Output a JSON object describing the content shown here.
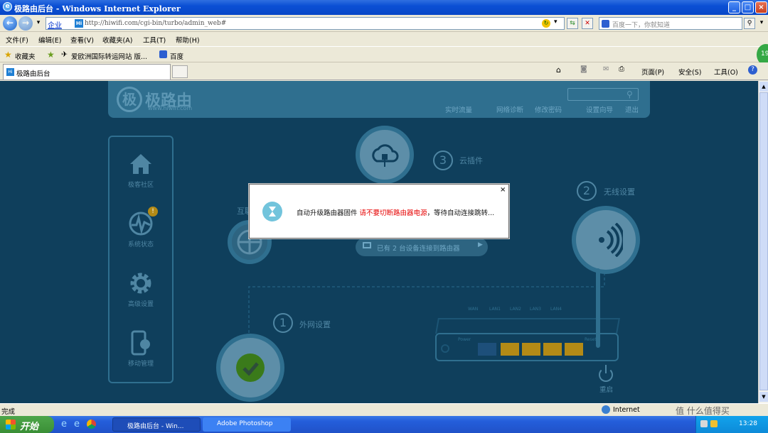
{
  "window": {
    "title": "极路由后台 - Windows Internet Explorer"
  },
  "address": {
    "zone": "企业",
    "url": "http://hiwifi.com/cgi-bin/turbo/admin_web#",
    "search_placeholder": "百度一下，你就知道"
  },
  "menu": [
    "文件(F)",
    "编辑(E)",
    "查看(V)",
    "收藏夹(A)",
    "工具(T)",
    "帮助(H)"
  ],
  "favorites": {
    "label": "收藏夹",
    "items": [
      "爱欧洲国际转运网站 版...",
      "百度"
    ]
  },
  "tab": {
    "title": "极路由后台"
  },
  "command_bar": [
    "页面(P)",
    "安全(S)",
    "工具(O)"
  ],
  "badge": "19",
  "page": {
    "logo_text": "极路由",
    "logo_sub": "www.hiwifi.com",
    "header_links": [
      "实时流量",
      "网络诊断",
      "修改密码",
      "设置向导",
      "退出"
    ],
    "sidebar": [
      "极客社区",
      "系统状态",
      "高级设置",
      "移动管理"
    ],
    "steps": [
      {
        "num": "3",
        "label": "云插件"
      },
      {
        "num": "2",
        "label": "无线设置"
      },
      {
        "num": "1",
        "label": "外网设置"
      }
    ],
    "internet_label": "互联",
    "devices_text": "已有 2 台设备连接到路由器",
    "ports": [
      "WAN",
      "LAN1",
      "LAN2",
      "LAN3",
      "LAN4"
    ],
    "power_label": "Power",
    "reset_label": "Reset",
    "reboot_label": "重启"
  },
  "dialog": {
    "close": "×",
    "msg_prefix": "自动升级路由器固件 ",
    "msg_warning": "请不要切断路由器电源",
    "msg_suffix": "，等待自动连接跳转..."
  },
  "statusbar": {
    "left": "完成",
    "zone": "Internet",
    "watermark": "值 什么值得买"
  },
  "taskbar": {
    "start": "开始",
    "tasks": [
      "极路由后台 - Win...",
      "Adobe Photoshop"
    ],
    "clock": "13:28"
  }
}
